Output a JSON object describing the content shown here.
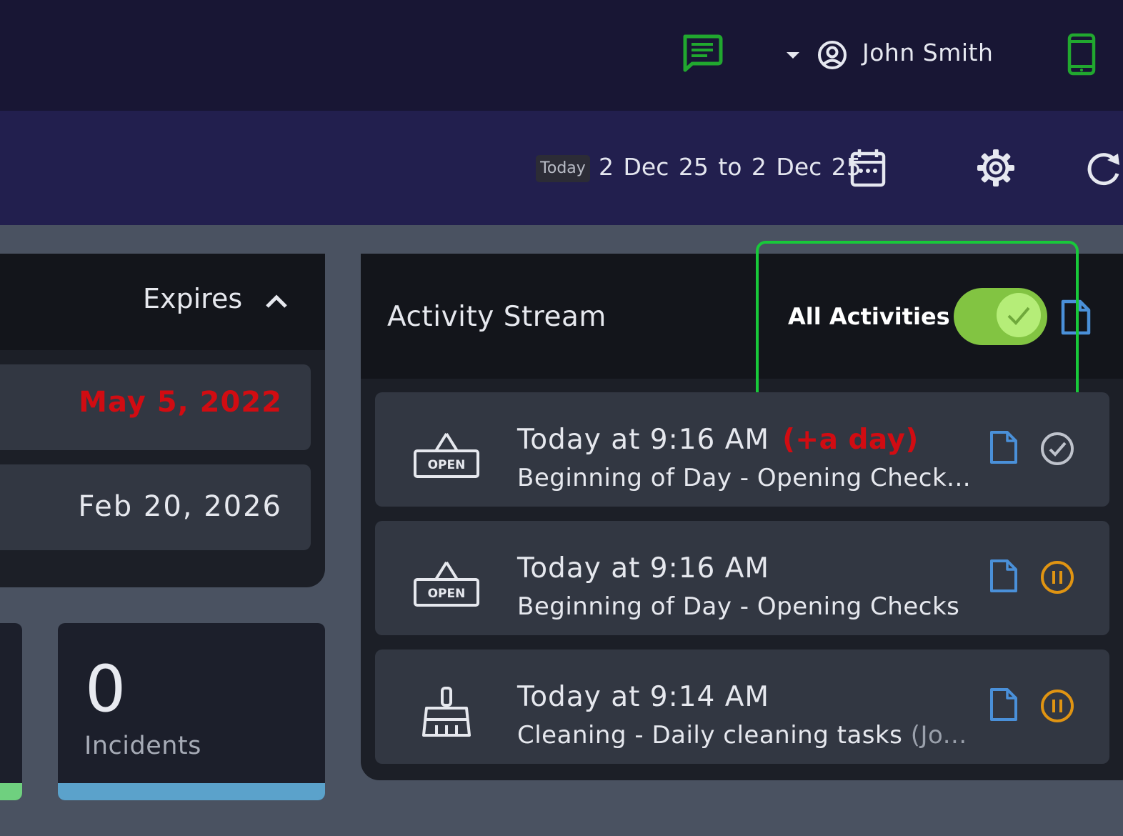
{
  "header": {
    "user_name": "John Smith",
    "icons": [
      "chat-icon",
      "caret-down-icon",
      "user-circle-icon",
      "mobile-phone-icon"
    ]
  },
  "filter": {
    "today_badge": "Today",
    "date_range": "2 Dec 25 to 2 Dec 25",
    "icons": [
      "calendar-icon",
      "gear-icon",
      "refresh-icon"
    ]
  },
  "expires_panel": {
    "header_label": "Expires",
    "rows": [
      {
        "date": "May 5, 2022",
        "status": "expired"
      },
      {
        "date": "Feb 20, 2026",
        "status": "active"
      }
    ]
  },
  "stats": {
    "incidents_count": "0",
    "incidents_label": "Incidents"
  },
  "activity": {
    "title": "Activity Stream",
    "filter_label": "All Activities",
    "filter_enabled": true,
    "items": [
      {
        "time": "Today at 9:16 AM",
        "late": "(+a day)",
        "description": "Beginning of Day - Opening Check...",
        "description_extra": "",
        "icon": "open-sign-icon",
        "status": "completed"
      },
      {
        "time": "Today at 9:16 AM",
        "late": "",
        "description": "Beginning of Day - Opening Checks",
        "description_extra": "",
        "icon": "open-sign-icon",
        "status": "paused"
      },
      {
        "time": "Today at 9:14 AM",
        "late": "",
        "description": "Cleaning - Daily cleaning tasks",
        "description_extra": "(Jo...",
        "icon": "broom-icon",
        "status": "paused"
      }
    ]
  },
  "colors": {
    "top_bar": "#181634",
    "filter_bar": "#221f4e",
    "accent_green": "#18c93a",
    "toggle_on": "#82c442",
    "alert_red": "#d10c12",
    "doc_blue": "#4a90d9",
    "paused_orange": "#e09412"
  }
}
